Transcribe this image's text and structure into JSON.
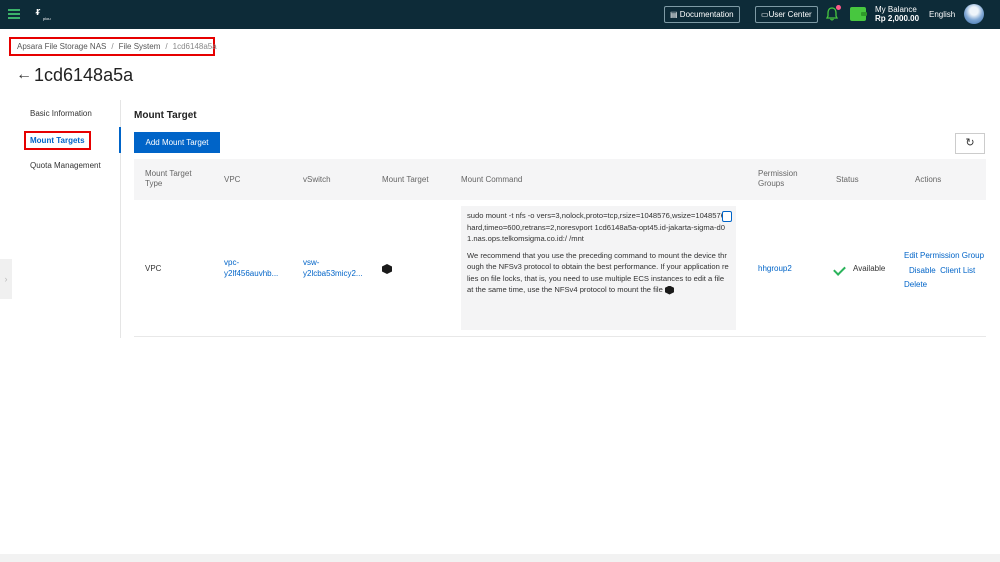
{
  "topbar": {
    "logo_text": "plou",
    "documentation_label": "Documentation",
    "user_center_label": "User Center",
    "balance_label": "My Balance",
    "balance_value": "Rp 2,000.00",
    "language": "English"
  },
  "breadcrumb": [
    "Apsara File Storage NAS",
    "File System",
    "1cd6148a5a"
  ],
  "page_title": "1cd6148a5a",
  "sidebar": {
    "items": [
      "Basic Information",
      "Mount Targets",
      "Quota Management"
    ],
    "active": "Mount Targets"
  },
  "main": {
    "section_title": "Mount Target",
    "add_button": "Add Mount Target",
    "table": {
      "columns": [
        "Mount Target Type",
        "VPC",
        "vSwitch",
        "Mount Target",
        "Mount Command",
        "Permission Groups",
        "Status",
        "Actions"
      ],
      "rows": [
        {
          "type": "VPC",
          "vpc": "vpc-y2lf456auvhb...",
          "vswitch": "vsw-y2lcba53micy2...",
          "mount_command": "sudo mount -t nfs -o vers=3,nolock,proto=tcp,rsize=1048576,wsize=1048576,hard,timeo=600,retrans=2,noresvport 1cd6148a5a-opt45.id-jakarta-sigma-d01.nas.ops.telkomsigma.co.id:/ /mnt",
          "mount_note": "We recommend that you use the preceding command to mount the device through the NFSv3 protocol to obtain the best performance. If your application relies on file locks, that is, you need to use multiple ECS instances to edit a file at the same time, use the NFSv4 protocol to mount the file",
          "permission_group": "hhgroup2",
          "status": "Available",
          "actions": [
            "Edit Permission Group",
            "Disable",
            "Client List",
            "Delete"
          ]
        }
      ]
    }
  },
  "colors": {
    "topbar": "#0d2b38",
    "accent": "#0064c8",
    "success": "#2bb35b",
    "highlight": "#e60000"
  }
}
